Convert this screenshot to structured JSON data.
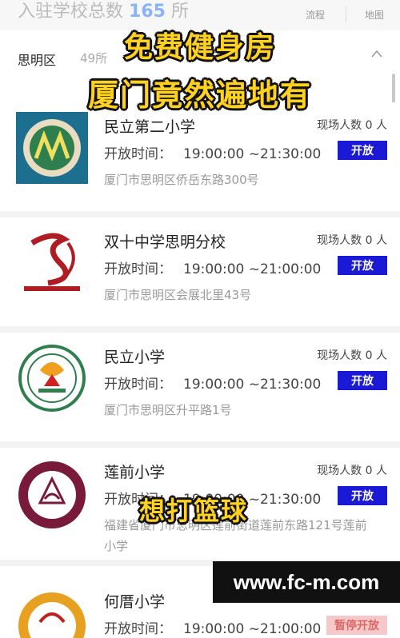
{
  "header": {
    "school_count_label": "入驻学校总数",
    "school_count": "165",
    "school_count_unit": "所",
    "menu_process": "流程",
    "menu_map": "地图"
  },
  "district": {
    "name": "思明区",
    "count": "49所"
  },
  "hours_label": "开放时间：",
  "people_label": "现场人数 0 人",
  "schools": [
    {
      "name": "民立第二小学",
      "hours": "19:00:00 ~21:30:00",
      "status": "开放",
      "address": "厦门市思明区侨岳东路300号"
    },
    {
      "name": "双十中学思明分校",
      "hours": "19:00:00 ~21:00:00",
      "status": "开放",
      "address": "厦门市思明区会展北里43号"
    },
    {
      "name": "民立小学",
      "hours": "19:00:00 ~21:30:00",
      "status": "开放",
      "address": "厦门市思明区升平路1号"
    },
    {
      "name": "莲前小学",
      "hours": "19:00:00 ~21:30:00",
      "status": "开放",
      "address": "福建省厦门市思明区莲前街道莲前东路121号莲前小学"
    },
    {
      "name": "何厝小学",
      "hours": "19:00:00 ~21:00:00",
      "status": "暂停开放",
      "address": ""
    }
  ],
  "overlay": {
    "line1": "免费健身房",
    "line2": "厦门竟然遍地有",
    "caption": "想打篮球",
    "watermark": "www.fc-m.com"
  },
  "colors": {
    "open_button": "#1a1ad6",
    "overlay_text": "#ffd21f",
    "count_highlight": "#8ab4f8"
  }
}
